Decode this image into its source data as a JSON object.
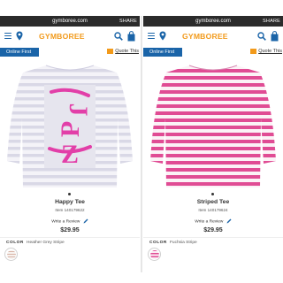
{
  "panels": [
    {
      "url": "gymboree.com",
      "share": "SHARE",
      "brand": "GYMBOREE",
      "badge": "Online First",
      "quote_link": "Quote This",
      "product_name": "Happy Tee",
      "item_number": "Item 140179622",
      "write_review": "Write a Review",
      "price": "$29.95",
      "color_label": "COLOR",
      "color_value": "Heather Grey Stripe",
      "graphic_text": "HAPPY",
      "stripe_color": "#d9d8e6",
      "graphic_color": "#e23fa8"
    },
    {
      "url": "gymboree.com",
      "share": "SHARE",
      "brand": "GYMBOREE",
      "badge": "Online First",
      "quote_link": "Quote This",
      "product_name": "Striped Tee",
      "item_number": "Item 140179624",
      "write_review": "Write a Review",
      "price": "$29.95",
      "color_label": "COLOR",
      "color_value": "Fuchsia Stripe",
      "stripe_color": "#e04c94"
    }
  ],
  "colors": {
    "brand_blue": "#1a64a8",
    "brand_orange": "#f29a1b"
  },
  "icons": [
    "menu-icon",
    "location-pin-icon",
    "search-icon",
    "shopping-bag-icon",
    "quote-icon",
    "pencil-icon"
  ]
}
